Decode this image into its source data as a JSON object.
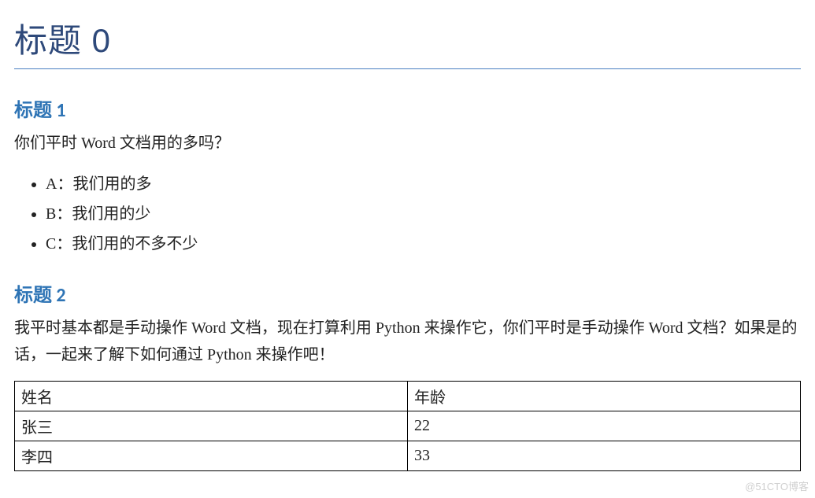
{
  "title_main": "标题 0",
  "sections": {
    "s1": {
      "heading": "标题 1",
      "question": "你们平时 Word 文档用的多吗？",
      "options": [
        {
          "label": "A",
          "text": "我们用的多"
        },
        {
          "label": "B",
          "text": "我们用的少"
        },
        {
          "label": "C",
          "text": "我们用的不多不少"
        }
      ]
    },
    "s2": {
      "heading": "标题 2",
      "paragraph": "我平时基本都是手动操作 Word 文档，现在打算利用 Python 来操作它，你们平时是手动操作 Word 文档？如果是的话，一起来了解下如何通过 Python 来操作吧！"
    }
  },
  "table": {
    "header": {
      "col1": "姓名",
      "col2": "年龄"
    },
    "rows": [
      {
        "col1": "张三",
        "col2": "22"
      },
      {
        "col1": "李四",
        "col2": "33"
      }
    ]
  },
  "watermark": "@51CTO博客"
}
